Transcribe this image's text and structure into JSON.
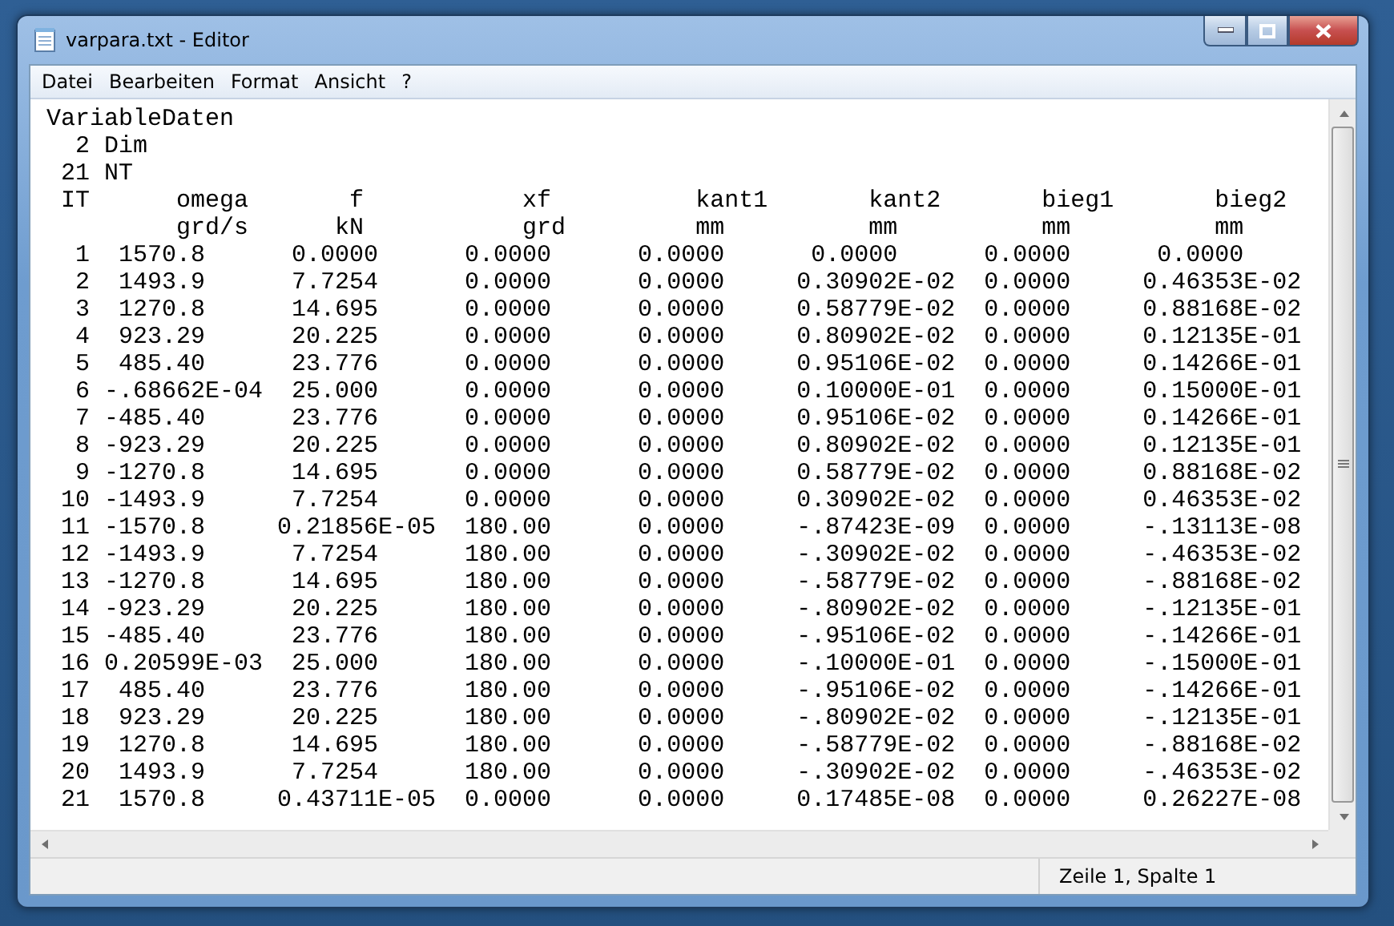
{
  "window": {
    "title": "varpara.txt - Editor"
  },
  "menu": [
    "Datei",
    "Bearbeiten",
    "Format",
    "Ansicht",
    "?"
  ],
  "document": {
    "lines": [
      "VariableDaten",
      "  2 Dim",
      " 21 NT",
      " IT      omega       f           xf          kant1       kant2       bieg1       bieg2",
      "         grd/s      kN           grd         mm          mm          mm          mm",
      "  1  1570.8      0.0000      0.0000      0.0000      0.0000      0.0000      0.0000",
      "  2  1493.9      7.7254      0.0000      0.0000     0.30902E-02  0.0000     0.46353E-02",
      "  3  1270.8      14.695      0.0000      0.0000     0.58779E-02  0.0000     0.88168E-02",
      "  4  923.29      20.225      0.0000      0.0000     0.80902E-02  0.0000     0.12135E-01",
      "  5  485.40      23.776      0.0000      0.0000     0.95106E-02  0.0000     0.14266E-01",
      "  6 -.68662E-04  25.000      0.0000      0.0000     0.10000E-01  0.0000     0.15000E-01",
      "  7 -485.40      23.776      0.0000      0.0000     0.95106E-02  0.0000     0.14266E-01",
      "  8 -923.29      20.225      0.0000      0.0000     0.80902E-02  0.0000     0.12135E-01",
      "  9 -1270.8      14.695      0.0000      0.0000     0.58779E-02  0.0000     0.88168E-02",
      " 10 -1493.9      7.7254      0.0000      0.0000     0.30902E-02  0.0000     0.46353E-02",
      " 11 -1570.8     0.21856E-05  180.00      0.0000     -.87423E-09  0.0000     -.13113E-08",
      " 12 -1493.9      7.7254      180.00      0.0000     -.30902E-02  0.0000     -.46353E-02",
      " 13 -1270.8      14.695      180.00      0.0000     -.58779E-02  0.0000     -.88168E-02",
      " 14 -923.29      20.225      180.00      0.0000     -.80902E-02  0.0000     -.12135E-01",
      " 15 -485.40      23.776      180.00      0.0000     -.95106E-02  0.0000     -.14266E-01",
      " 16 0.20599E-03  25.000      180.00      0.0000     -.10000E-01  0.0000     -.15000E-01",
      " 17  485.40      23.776      180.00      0.0000     -.95106E-02  0.0000     -.14266E-01",
      " 18  923.29      20.225      180.00      0.0000     -.80902E-02  0.0000     -.12135E-01",
      " 19  1270.8      14.695      180.00      0.0000     -.58779E-02  0.0000     -.88168E-02",
      " 20  1493.9      7.7254      180.00      0.0000     -.30902E-02  0.0000     -.46353E-02",
      " 21  1570.8     0.43711E-05  0.0000      0.0000     0.17485E-08  0.0000     0.26227E-08"
    ]
  },
  "status_bar": {
    "position": "Zeile 1, Spalte 1"
  }
}
